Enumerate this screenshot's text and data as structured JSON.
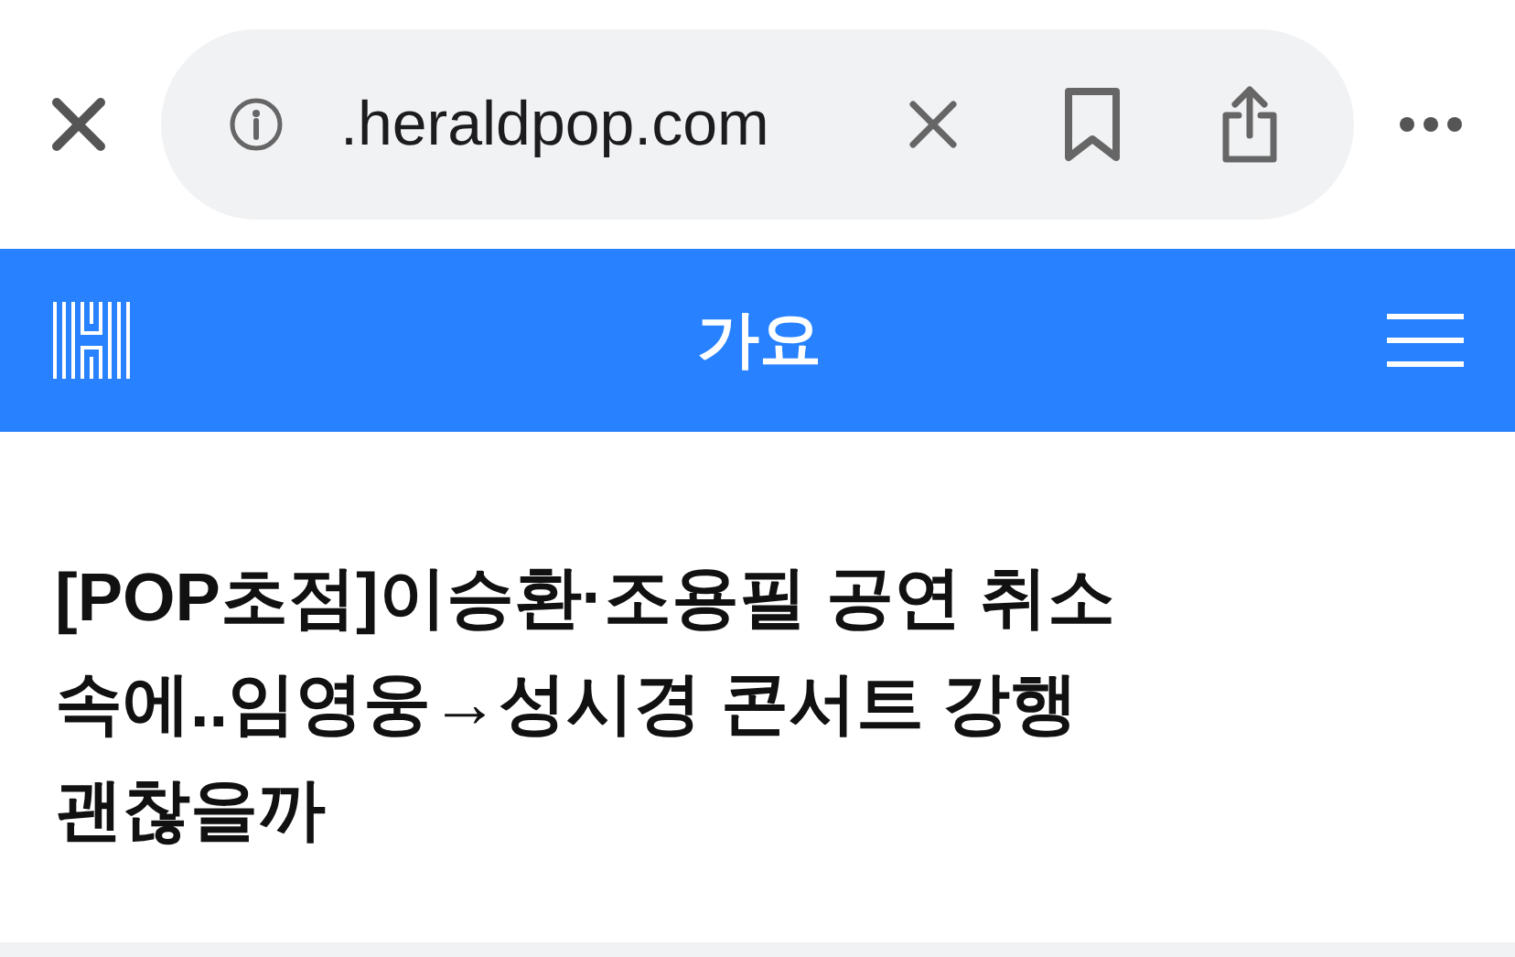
{
  "browser": {
    "url": ".heraldpop.com"
  },
  "header": {
    "section": "가요"
  },
  "article": {
    "headline_lines": [
      "[POP초점]이승환·조용필 공연 취소",
      "속에..임영웅→성시경 콘서트 강행",
      "괜찮을까"
    ]
  }
}
